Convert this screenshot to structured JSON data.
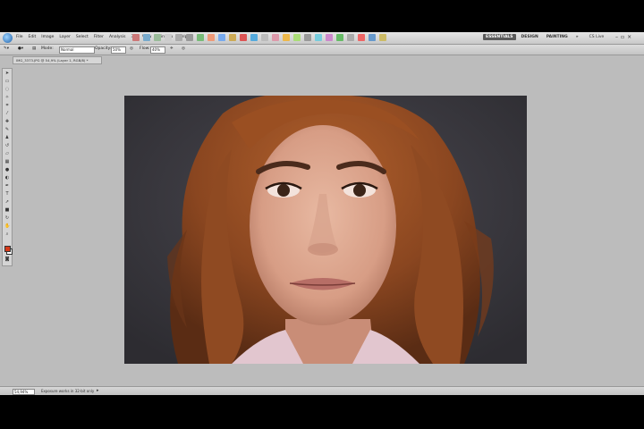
{
  "menu": [
    "File",
    "Edit",
    "Image",
    "Layer",
    "Select",
    "Filter",
    "Analysis",
    "3D",
    "View",
    "Window",
    "Help"
  ],
  "workspace": {
    "essentials": "ESSENTIALS",
    "design": "DESIGN",
    "painting": "PAINTING",
    "more": "»",
    "cslive": "CS Live"
  },
  "window_controls": {
    "minimize": "–",
    "restore": "▫",
    "close": "×"
  },
  "options": {
    "mode_label": "Mode:",
    "mode_value": "Normal",
    "opacity_label": "Opacity:",
    "opacity_value": "50%",
    "flow_label": "Flow:",
    "flow_value": "40%"
  },
  "document_tab": "IMG_3373.JPG @ 54,9% (Layer 1, RGB/8) *",
  "status": {
    "zoom": "54,94%",
    "doc_info": "Exposure works in 32-bit only"
  },
  "colors": {
    "foreground": "#d63a1a",
    "background": "#ffffff",
    "accent": "#5a5a5a"
  },
  "icons": [
    "ps-logo-icon",
    "move-tool-icon",
    "marquee-tool-icon",
    "lasso-tool-icon",
    "crop-tool-icon",
    "eyedropper-tool-icon",
    "healing-tool-icon",
    "brush-tool-icon",
    "stamp-tool-icon",
    "eraser-tool-icon",
    "gradient-tool-icon",
    "dodge-tool-icon",
    "pen-tool-icon",
    "type-tool-icon",
    "path-tool-icon",
    "shape-tool-icon",
    "hand-tool-icon",
    "zoom-tool-icon"
  ]
}
